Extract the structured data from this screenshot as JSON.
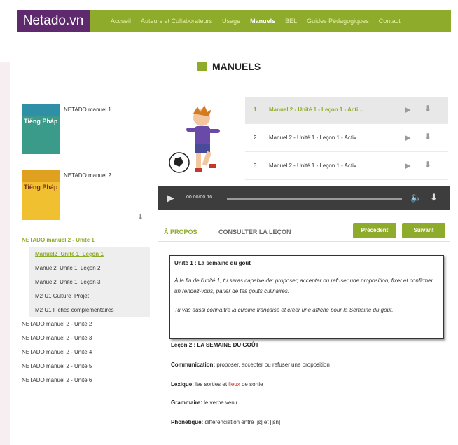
{
  "header": {
    "logo": "Netado.vn",
    "nav": [
      "Accueil",
      "Auteurs et Collaborateurs",
      "Usage",
      "Manuels",
      "BEL",
      "Guides Pédagogiques",
      "Contact"
    ],
    "active_nav": "Manuels",
    "brand_color": "#8fab2c",
    "logo_bg": "#5e2a6d"
  },
  "page_title": "MANUELS",
  "sidebar": {
    "books": [
      {
        "label": "NETADO manuel 1",
        "cover_text": "Tiếng Pháp"
      },
      {
        "label": "NETADO manuel 2",
        "cover_text": "Tiếng Pháp"
      }
    ],
    "active_unit": "NETADO manuel 2 - Unité  1",
    "lessons": [
      "Manuel2_Unité 1_Leçon 1",
      "Manuel2_Unité 1_Leçon 2",
      "Manuel2_Unité 1_Leçon 3",
      "M2 U1 Culture_Projet",
      "M2 U1 Fiches complémentaires"
    ],
    "other_units": [
      "NETADO manuel 2 - Unité  2",
      "NETADO manuel 2 - Unité  3",
      "NETADO manuel 2 - Unité  4",
      "NETADO manuel 2 - Unité  5",
      "NETADO manuel 2 - Unité  6"
    ]
  },
  "tracks": [
    {
      "num": "1",
      "name": "Manuel 2 - Unité 1 - Leçon 1 - Acti..."
    },
    {
      "num": "2",
      "name": "Manuel 2 - Unité 1 - Leçon 1 - Activ..."
    },
    {
      "num": "3",
      "name": "Manuel 2 - Unité 1 - Leçon 1 - Activ..."
    }
  ],
  "player": {
    "time": "00:00/00:16",
    "progress": 0
  },
  "tabs": {
    "about": "À PROPOS",
    "consult": "CONSULTER LA LEÇON"
  },
  "buttons": {
    "prev": "Précédent",
    "next": "Suivant"
  },
  "content": {
    "unit_title": "Unité 1 : La semaine du goût",
    "unit_p1": "À la fin de l'unité 1, tu seras capable de: proposer, accepter ou refuser une proposition, fixer et confirmer un rendez-vous, parler de tes goûts culinaires.",
    "unit_p2": "Tu vas aussi connaître la cuisine française et créer une affiche pour la Semaine du goût.",
    "lecon_title": "Leçon 2 : LA SEMAINE DU GOÛT",
    "communication_label": "Communication:",
    "communication_text": " proposer, accepter ou refuser une proposition",
    "lexique_label": "Lexique:",
    "lexique_text": " les sorties et ",
    "lexique_red": "lieux",
    "lexique_tail": " de sortie",
    "grammaire_label": "Grammaire:",
    "grammaire_text": " le verbe venir",
    "phonetique_label": "Phonétique:",
    "phonetique_text": " différenciation entre [jɛ̃] et [jɛn]"
  }
}
